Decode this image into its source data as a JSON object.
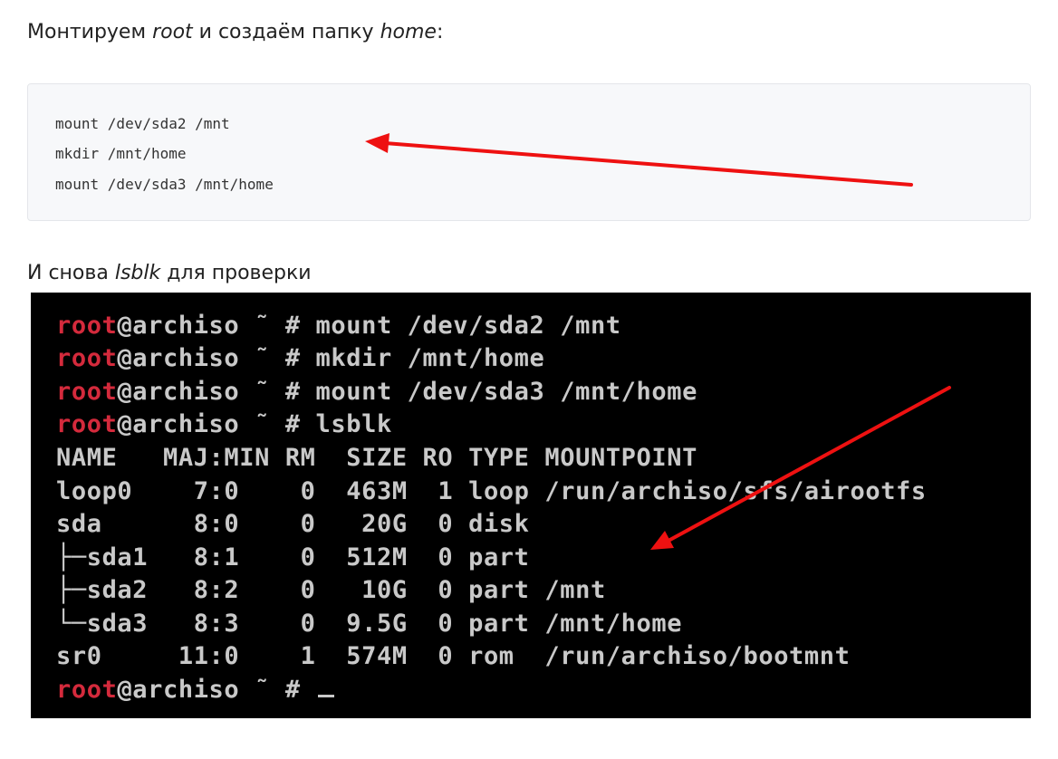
{
  "paragraph1": {
    "before": "Монтируем ",
    "em1": "root",
    "middle": " и создаём папку ",
    "em2": "home",
    "after": ":"
  },
  "code_lines": [
    "mount /dev/sda2 /mnt",
    "mkdir /mnt/home",
    "mount /dev/sda3 /mnt/home"
  ],
  "paragraph2": {
    "before": "И снова ",
    "em": "lsblk",
    "after": " для проверки"
  },
  "terminal": {
    "prompt_user": "root",
    "prompt_rest": "@archiso ˜ # ",
    "commands": [
      "mount /dev/sda2 /mnt",
      "mkdir /mnt/home",
      "mount /dev/sda3 /mnt/home",
      "lsblk"
    ],
    "lsblk_lines": [
      "NAME   MAJ:MIN RM  SIZE RO TYPE MOUNTPOINT",
      "loop0    7:0    0  463M  1 loop /run/archiso/sfs/airootfs",
      "sda      8:0    0   20G  0 disk",
      "├─sda1   8:1    0  512M  0 part",
      "├─sda2   8:2    0   10G  0 part /mnt",
      "└─sda3   8:3    0  9.5G  0 part /mnt/home",
      "sr0     11:0    1  574M  0 rom  /run/archiso/bootmnt"
    ]
  },
  "colors": {
    "arrow": "#ee1111",
    "prompt_user": "#d42a3c",
    "terminal_bg": "#000000",
    "code_bg": "#f7f8fa"
  }
}
